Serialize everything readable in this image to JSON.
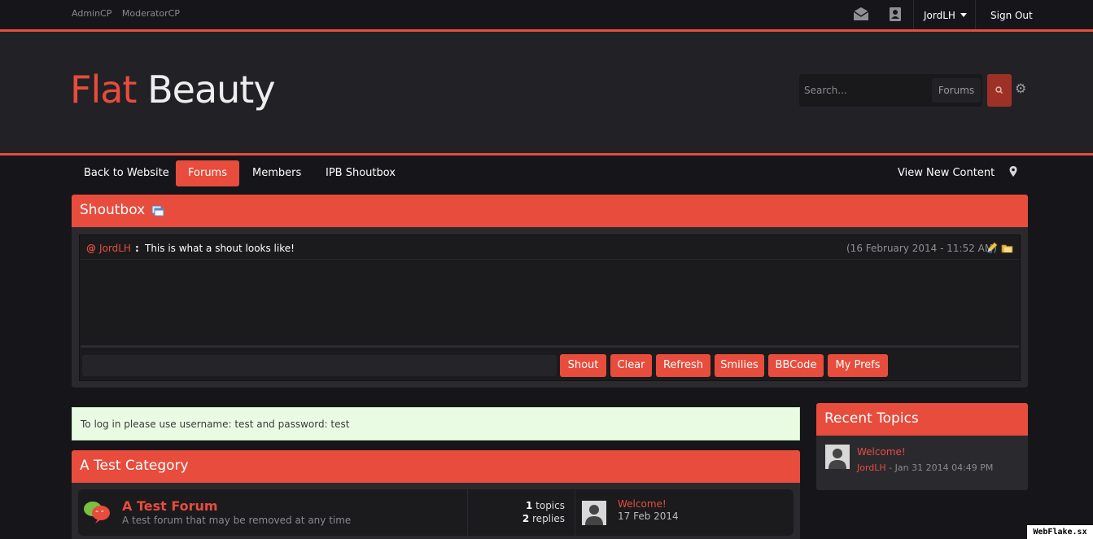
{
  "topbar": {
    "admin_cp": "AdminCP",
    "moderator_cp": "ModeratorCP",
    "username": "JordLH",
    "sign_out": "Sign Out",
    "icons": [
      "envelope-icon",
      "contact-card-icon"
    ]
  },
  "header": {
    "logo_word1": "Flat",
    "logo_word2": "Beauty",
    "search_placeholder": "Search...",
    "search_scope": "Forums",
    "accent_color": "#e74c3c"
  },
  "nav": {
    "items": [
      "Back to Website",
      "Forums",
      "Members",
      "IPB Shoutbox"
    ],
    "active": "Forums",
    "view_new": "View New Content"
  },
  "shoutbox": {
    "title": "Shoutbox",
    "shouts": [
      {
        "at": "@",
        "user": "JordLH",
        "sep": ":",
        "message": "This is what a shout looks like!",
        "time": "(16 February 2014 - 11:52 AM)"
      }
    ],
    "buttons": [
      "Shout",
      "Clear",
      "Refresh",
      "Smilies",
      "BBCode",
      "My Prefs"
    ]
  },
  "notice": "To log in please use username: test and password: test",
  "category": {
    "title": "A Test Category",
    "forums": [
      {
        "name": "A Test Forum",
        "description": "A test forum that may be removed at any time",
        "topics_count": "1",
        "topics_label": "topics",
        "replies_count": "2",
        "replies_label": "replies",
        "last_post_title": "Welcome!",
        "last_post_date": "17 Feb 2014"
      }
    ]
  },
  "recent_topics": {
    "title": "Recent Topics",
    "items": [
      {
        "title": "Welcome!",
        "author": "JordLH",
        "date": " - Jan 31 2014 04:49 PM"
      }
    ]
  },
  "watermark": "WebFlake.sx"
}
